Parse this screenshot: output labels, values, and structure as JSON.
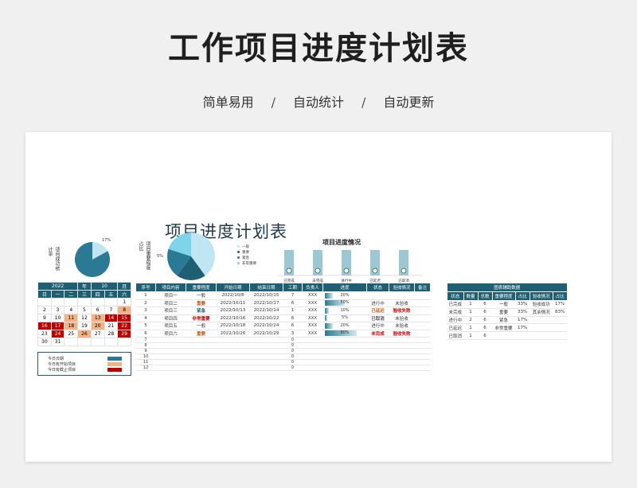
{
  "hero": {
    "title": "工作项目进度计划表",
    "sub": [
      "简单易用",
      "自动统计",
      "自动更新"
    ],
    "sep": "/"
  },
  "sheet_title": "项目进度计划表",
  "colors": {
    "primary": "#1e5f73",
    "mid": "#2a7a95",
    "light": "#bfe6f2",
    "red": "#c00000",
    "orange": "#f4b183"
  },
  "pie1": {
    "label": "项目成功统计率",
    "pct_label": "17%"
  },
  "pie2": {
    "label": "项目重要程度占比",
    "pct_label": "5%",
    "legend": [
      "一般",
      "重要",
      "紧急",
      "非常重要"
    ]
  },
  "chart_data": [
    {
      "type": "pie",
      "title": "",
      "slices": [
        {
          "name": "",
          "value": 17
        },
        {
          "name": "",
          "value": 83
        }
      ]
    },
    {
      "type": "pie",
      "title": "",
      "slices": [
        {
          "name": "一般",
          "value": 40
        },
        {
          "name": "重要",
          "value": 20
        },
        {
          "name": "紧急",
          "value": 20
        },
        {
          "name": "非常重要",
          "value": 20
        }
      ]
    },
    {
      "type": "bar",
      "title": "项目进度情况",
      "categories": [
        "已完成",
        "未完成",
        "进行中",
        "已延迟",
        "已取消"
      ],
      "values": [
        1,
        1,
        1,
        1,
        1
      ]
    }
  ],
  "calendar": {
    "year": "2022",
    "year_unit": "年",
    "month": "10",
    "month_unit": "月",
    "dow": [
      "日",
      "一",
      "二",
      "三",
      "四",
      "五",
      "六"
    ],
    "weeks": [
      [
        "",
        "",
        "",
        "",
        "",
        "",
        "1"
      ],
      [
        "2",
        "3",
        "4",
        "5",
        "6",
        "7",
        "8"
      ],
      [
        "9",
        "10",
        "11",
        "12",
        "13",
        "14",
        "15"
      ],
      [
        "16",
        "17",
        "18",
        "19",
        "20",
        "21",
        "22"
      ],
      [
        "23",
        "24",
        "25",
        "26",
        "27",
        "28",
        "29"
      ],
      [
        "30",
        "31",
        "",
        "",
        "",
        "",
        ""
      ]
    ],
    "legend": [
      "今日日期",
      "今日有开始项目",
      "今日有截止项目"
    ]
  },
  "table": {
    "headers": [
      "序号",
      "项目内容",
      "重要程度",
      "开始日期",
      "结束日期",
      "工期",
      "负责人",
      "进度",
      "状态",
      "验收情况",
      "备注"
    ],
    "rows": [
      {
        "no": "1",
        "name": "项目一",
        "imp": "一般",
        "start": "2022/10/8",
        "end": "2022/10/15",
        "days": "7",
        "owner": "XXX",
        "prog": "20%",
        "pv": 20,
        "status": "",
        "check": "",
        "note": ""
      },
      {
        "no": "2",
        "name": "项目二",
        "imp": "重要",
        "start": "2022/10/11",
        "end": "2022/10/17",
        "days": "6",
        "owner": "XXX",
        "prog": "50%",
        "pv": 50,
        "status": "进行中",
        "check": "未验收",
        "note": ""
      },
      {
        "no": "3",
        "name": "项目三",
        "imp": "紧急",
        "start": "2022/10/13",
        "end": "2022/10/14",
        "days": "1",
        "owner": "XXX",
        "prog": "10%",
        "pv": 10,
        "status": "已延迟",
        "check": "验收失败",
        "note": ""
      },
      {
        "no": "4",
        "name": "项目四",
        "imp": "非常重要",
        "start": "2022/10/16",
        "end": "2022/10/22",
        "days": "6",
        "owner": "XXX",
        "prog": "5%",
        "pv": 5,
        "status": "已取消",
        "check": "未验收",
        "note": ""
      },
      {
        "no": "5",
        "name": "项目五",
        "imp": "一般",
        "start": "2022/10/18",
        "end": "2022/10/24",
        "days": "6",
        "owner": "XXX",
        "prog": "20%",
        "pv": 20,
        "status": "进行中",
        "check": "未验收",
        "note": ""
      },
      {
        "no": "6",
        "name": "项目六",
        "imp": "重要",
        "start": "2022/10/26",
        "end": "2022/10/29",
        "days": "3",
        "owner": "XXX",
        "prog": "80%",
        "pv": 80,
        "status": "未完成",
        "check": "验收失败",
        "note": ""
      }
    ],
    "empty_rows": [
      "7",
      "8",
      "9",
      "10",
      "11",
      "12"
    ],
    "empty_days": "0"
  },
  "aux": {
    "title": "图表辅助数据",
    "headers": [
      "状态",
      "数量",
      "总数",
      "重要程度",
      "占比",
      "验收情况",
      "占比"
    ],
    "rows": [
      [
        "已完成",
        "1",
        "6",
        "一般",
        "33%",
        "验收成功",
        "17%"
      ],
      [
        "未完成",
        "1",
        "6",
        "重要",
        "33%",
        "其余情况",
        "83%"
      ],
      [
        "进行中",
        "2",
        "6",
        "紧急",
        "17%",
        "",
        ""
      ],
      [
        "已延迟",
        "1",
        "6",
        "非常重要",
        "17%",
        "",
        ""
      ],
      [
        "已取消",
        "1",
        "6",
        "",
        "",
        "",
        ""
      ]
    ]
  }
}
